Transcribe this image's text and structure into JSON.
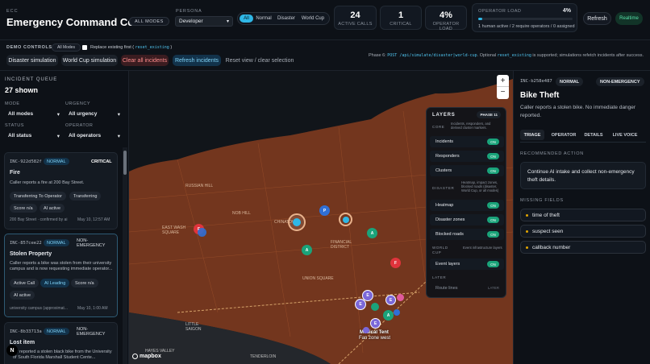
{
  "header": {
    "eyebrow": "ECC",
    "title": "Emergency Command Center",
    "mode_badge": "ALL MODES",
    "persona_label": "PERSONA",
    "persona_value": "Developer",
    "filters": [
      "All",
      "Normal",
      "Disaster",
      "World Cup"
    ],
    "stats": [
      {
        "value": "24",
        "label": "ACTIVE CALLS"
      },
      {
        "value": "1",
        "label": "CRITICAL"
      },
      {
        "value": "4%",
        "label": "OPERATOR LOAD"
      }
    ],
    "load": {
      "title": "OPERATOR LOAD",
      "percent": "4%",
      "fraction": 0.04,
      "detail": "1 human active / 2 require operators / 0 assigned"
    },
    "refresh_label": "Refresh",
    "realtime_label": "Realtime"
  },
  "demo": {
    "label": "DEMO CONTROLS",
    "mode_chip": "All Modes",
    "checkbox_label": "Replace existing first (",
    "checkbox_code": "reset_existing",
    "checkbox_end": ")",
    "buttons": [
      "Disaster simulation",
      "World Cup simulation",
      "Clear all incidents",
      "Refresh incidents",
      "Reset view / clear selection"
    ],
    "note_phase": "Phase 6:",
    "note_endpoint": "POST /api/simulate/disaster|world-cup",
    "note_mid": ". Optional",
    "note_code": "reset_existing",
    "note_end": "is supported; simulations refetch incidents after success."
  },
  "queue": {
    "title": "INCIDENT QUEUE",
    "count": "27 shown",
    "mode_label": "MODE",
    "mode_value": "All modes",
    "urgency_label": "URGENCY",
    "urgency_value": "All urgency",
    "status_label": "STATUS",
    "status_value": "All status",
    "operator_label": "OPERATOR",
    "operator_value": "All operators",
    "cards": [
      {
        "id": "INC-922d582f",
        "tag1": "NORMAL",
        "tag2": "CRITICAL",
        "title": "Fire",
        "desc": "Caller reports a fire at 200 Bay Street.",
        "chips": [
          "Transferring To Operator",
          "Transferring",
          "Score n/a",
          "AI active"
        ],
        "footer": "200 Bay Street · confirmed by ai",
        "time": "May 10, 12:57 AM"
      },
      {
        "id": "INC-857cee22",
        "tag1": "NORMAL",
        "tag2": "NON-EMERGENCY",
        "title": "Stolen Property",
        "desc": "Caller reports a bike was stolen from their university campus and is now requesting immediate operator...",
        "chips": [
          "Active Call",
          "AI Leading",
          "Score n/a",
          "AI active"
        ],
        "footer": "university campus (approximat...",
        "time": "May 10, 1:00 AM"
      },
      {
        "id": "INC-8b33713a",
        "tag1": "NORMAL",
        "tag2": "NON-EMERGENCY",
        "title": "Lost item",
        "desc": "...r reported a stolen black bike from the University of South Florida Marshall Student Cente..."
      }
    ]
  },
  "map": {
    "attribution": "mapbox",
    "labels": [
      "EAST WASH SQUARE",
      "FINANCIAL DISTRICT",
      "CHINATOWN",
      "NOB HILL",
      "RUSSIAN HILL",
      "Medical Tent",
      "Fan zone west",
      "LITTLE SAIGON",
      "HAYES VALLEY",
      "UNION SQUARE",
      "TENDERLOIN"
    ],
    "layers": {
      "title": "LAYERS",
      "phase": "PHASE 11",
      "core_label": "CORE",
      "core_note": "Incidents, responders, and derived cluster markers.",
      "core_items": [
        "Incidents",
        "Responders",
        "Clusters"
      ],
      "disaster_label": "DISASTER",
      "disaster_note": "Heatmap, impact zones, blocked roads (disaster, World Cup, or all modes)",
      "disaster_items": [
        "Heatmap",
        "Disaster zones",
        "Blocked roads"
      ],
      "worldcup_label": "WORLD CUP",
      "worldcup_note": "Event infrastructure layers",
      "worldcup_items": [
        "Event layers"
      ],
      "later_label": "LATER",
      "later_items": [
        "Route lines"
      ],
      "later_state": "LATER",
      "on_label": "ON"
    }
  },
  "detail": {
    "id": "INC-b258e487",
    "tag1": "NORMAL",
    "tag2": "NON-EMERGENCY",
    "title": "Bike Theft",
    "desc": "Caller reports a stolen bike. No immediate danger reported.",
    "tabs": [
      "TRIAGE",
      "OPERATOR",
      "DETAILS",
      "LIVE VOICE"
    ],
    "action_label": "RECOMMENDED ACTION",
    "action_text": "Continue AI intake and collect non-emergency theft details.",
    "missing_label": "MISSING FIELDS",
    "missing": [
      "time of theft",
      "suspect seen",
      "callback number"
    ]
  },
  "colors": {
    "accent": "#2fb7e6",
    "critical": "#e0343c",
    "responder": "#1aa37a",
    "event": "#7b68d8",
    "zone": "#c0542a"
  }
}
